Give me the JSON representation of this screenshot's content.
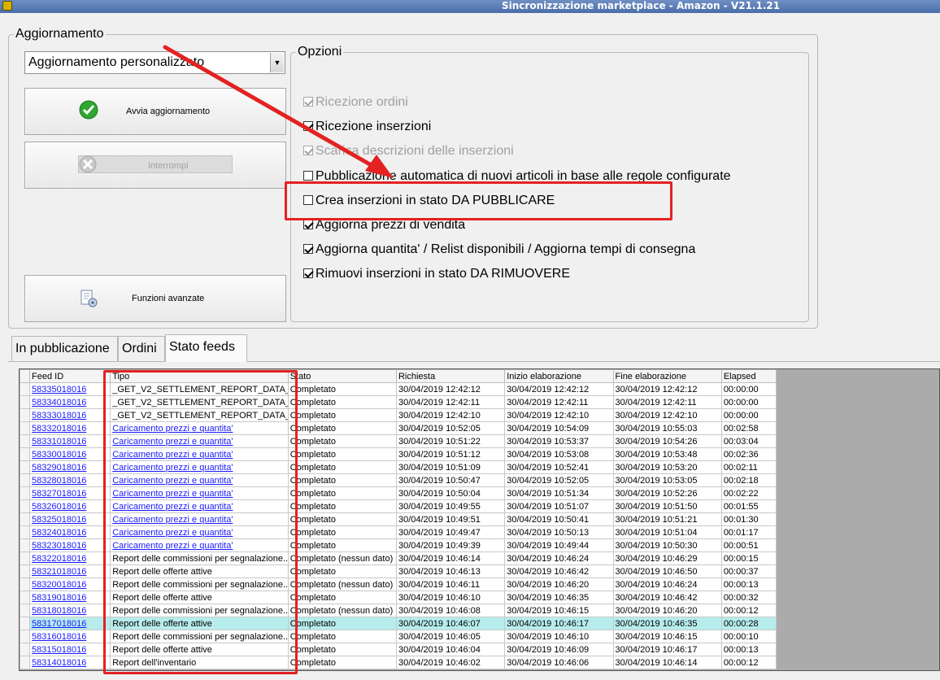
{
  "window": {
    "title": "Sincronizzazione marketplace - Amazon - V21.1.21"
  },
  "update_group": {
    "label": "Aggiornamento",
    "mode_value": "Aggiornamento personalizzato",
    "start_label": "Avvia aggiornamento",
    "stop_label": "Interrompi",
    "advanced_label": "Funzioni avanzate"
  },
  "options": {
    "label": "Opzioni",
    "items": [
      {
        "label": "Ricezione ordini",
        "checked": true,
        "disabled": true
      },
      {
        "label": "Ricezione inserzioni",
        "checked": true,
        "disabled": false
      },
      {
        "label": "Scarica descrizioni delle inserzioni",
        "checked": true,
        "disabled": true
      },
      {
        "label": "Pubblicazione automatica di nuovi articoli in base alle regole configurate",
        "checked": false,
        "disabled": false
      },
      {
        "label": "Crea inserzioni in stato DA PUBBLICARE",
        "checked": false,
        "disabled": false
      },
      {
        "label": "Aggiorna prezzi di vendita",
        "checked": true,
        "disabled": false
      },
      {
        "label": "Aggiorna quantita' / Relist disponibili / Aggiorna tempi di consegna",
        "checked": true,
        "disabled": false
      },
      {
        "label": "Rimuovi inserzioni in stato DA RIMUOVERE",
        "checked": true,
        "disabled": false
      }
    ]
  },
  "tabs": [
    {
      "label": "In pubblicazione",
      "active": false
    },
    {
      "label": "Ordini",
      "active": false
    },
    {
      "label": "Stato feeds",
      "active": true
    }
  ],
  "feeds_table": {
    "columns": [
      "Feed ID",
      "Tipo",
      "Stato",
      "Richiesta",
      "Inizio elaborazione",
      "Fine elaborazione",
      "Elapsed"
    ],
    "rows": [
      {
        "id": "58335018016",
        "tipo": "_GET_V2_SETTLEMENT_REPORT_DATA_...",
        "tipo_link": false,
        "stato": "Completato",
        "richiesta": "30/04/2019 12:42:12",
        "inizio": "30/04/2019 12:42:12",
        "fine": "30/04/2019 12:42:12",
        "elapsed": "00:00:00"
      },
      {
        "id": "58334018016",
        "tipo": "_GET_V2_SETTLEMENT_REPORT_DATA_...",
        "tipo_link": false,
        "stato": "Completato",
        "richiesta": "30/04/2019 12:42:11",
        "inizio": "30/04/2019 12:42:11",
        "fine": "30/04/2019 12:42:11",
        "elapsed": "00:00:00"
      },
      {
        "id": "58333018016",
        "tipo": "_GET_V2_SETTLEMENT_REPORT_DATA_...",
        "tipo_link": false,
        "stato": "Completato",
        "richiesta": "30/04/2019 12:42:10",
        "inizio": "30/04/2019 12:42:10",
        "fine": "30/04/2019 12:42:10",
        "elapsed": "00:00:00"
      },
      {
        "id": "58332018016",
        "tipo": "Caricamento prezzi e quantita'",
        "tipo_link": true,
        "stato": "Completato",
        "richiesta": "30/04/2019 10:52:05",
        "inizio": "30/04/2019 10:54:09",
        "fine": "30/04/2019 10:55:03",
        "elapsed": "00:02:58"
      },
      {
        "id": "58331018016",
        "tipo": "Caricamento prezzi e quantita'",
        "tipo_link": true,
        "stato": "Completato",
        "richiesta": "30/04/2019 10:51:22",
        "inizio": "30/04/2019 10:53:37",
        "fine": "30/04/2019 10:54:26",
        "elapsed": "00:03:04"
      },
      {
        "id": "58330018016",
        "tipo": "Caricamento prezzi e quantita'",
        "tipo_link": true,
        "stato": "Completato",
        "richiesta": "30/04/2019 10:51:12",
        "inizio": "30/04/2019 10:53:08",
        "fine": "30/04/2019 10:53:48",
        "elapsed": "00:02:36"
      },
      {
        "id": "58329018016",
        "tipo": "Caricamento prezzi e quantita'",
        "tipo_link": true,
        "stato": "Completato",
        "richiesta": "30/04/2019 10:51:09",
        "inizio": "30/04/2019 10:52:41",
        "fine": "30/04/2019 10:53:20",
        "elapsed": "00:02:11"
      },
      {
        "id": "58328018016",
        "tipo": "Caricamento prezzi e quantita'",
        "tipo_link": true,
        "stato": "Completato",
        "richiesta": "30/04/2019 10:50:47",
        "inizio": "30/04/2019 10:52:05",
        "fine": "30/04/2019 10:53:05",
        "elapsed": "00:02:18"
      },
      {
        "id": "58327018016",
        "tipo": "Caricamento prezzi e quantita'",
        "tipo_link": true,
        "stato": "Completato",
        "richiesta": "30/04/2019 10:50:04",
        "inizio": "30/04/2019 10:51:34",
        "fine": "30/04/2019 10:52:26",
        "elapsed": "00:02:22"
      },
      {
        "id": "58326018016",
        "tipo": "Caricamento prezzi e quantita'",
        "tipo_link": true,
        "stato": "Completato",
        "richiesta": "30/04/2019 10:49:55",
        "inizio": "30/04/2019 10:51:07",
        "fine": "30/04/2019 10:51:50",
        "elapsed": "00:01:55"
      },
      {
        "id": "58325018016",
        "tipo": "Caricamento prezzi e quantita'",
        "tipo_link": true,
        "stato": "Completato",
        "richiesta": "30/04/2019 10:49:51",
        "inizio": "30/04/2019 10:50:41",
        "fine": "30/04/2019 10:51:21",
        "elapsed": "00:01:30"
      },
      {
        "id": "58324018016",
        "tipo": "Caricamento prezzi e quantita'",
        "tipo_link": true,
        "stato": "Completato",
        "richiesta": "30/04/2019 10:49:47",
        "inizio": "30/04/2019 10:50:13",
        "fine": "30/04/2019 10:51:04",
        "elapsed": "00:01:17"
      },
      {
        "id": "58323018016",
        "tipo": "Caricamento prezzi e quantita'",
        "tipo_link": true,
        "stato": "Completato",
        "richiesta": "30/04/2019 10:49:39",
        "inizio": "30/04/2019 10:49:44",
        "fine": "30/04/2019 10:50:30",
        "elapsed": "00:00:51"
      },
      {
        "id": "58322018016",
        "tipo": "Report delle commissioni per segnalazione...",
        "tipo_link": false,
        "stato": "Completato (nessun dato)",
        "richiesta": "30/04/2019 10:46:14",
        "inizio": "30/04/2019 10:46:24",
        "fine": "30/04/2019 10:46:29",
        "elapsed": "00:00:15"
      },
      {
        "id": "58321018016",
        "tipo": "Report delle offerte attive",
        "tipo_link": false,
        "stato": "Completato",
        "richiesta": "30/04/2019 10:46:13",
        "inizio": "30/04/2019 10:46:42",
        "fine": "30/04/2019 10:46:50",
        "elapsed": "00:00:37"
      },
      {
        "id": "58320018016",
        "tipo": "Report delle commissioni per segnalazione...",
        "tipo_link": false,
        "stato": "Completato (nessun dato)",
        "richiesta": "30/04/2019 10:46:11",
        "inizio": "30/04/2019 10:46:20",
        "fine": "30/04/2019 10:46:24",
        "elapsed": "00:00:13"
      },
      {
        "id": "58319018016",
        "tipo": "Report delle offerte attive",
        "tipo_link": false,
        "stato": "Completato",
        "richiesta": "30/04/2019 10:46:10",
        "inizio": "30/04/2019 10:46:35",
        "fine": "30/04/2019 10:46:42",
        "elapsed": "00:00:32"
      },
      {
        "id": "58318018016",
        "tipo": "Report delle commissioni per segnalazione...",
        "tipo_link": false,
        "stato": "Completato (nessun dato)",
        "richiesta": "30/04/2019 10:46:08",
        "inizio": "30/04/2019 10:46:15",
        "fine": "30/04/2019 10:46:20",
        "elapsed": "00:00:12"
      },
      {
        "id": "58317018016",
        "tipo": "Report delle offerte attive",
        "tipo_link": false,
        "stato": "Completato",
        "richiesta": "30/04/2019 10:46:07",
        "inizio": "30/04/2019 10:46:17",
        "fine": "30/04/2019 10:46:35",
        "elapsed": "00:00:28",
        "selected": true
      },
      {
        "id": "58316018016",
        "tipo": "Report delle commissioni per segnalazione...",
        "tipo_link": false,
        "stato": "Completato",
        "richiesta": "30/04/2019 10:46:05",
        "inizio": "30/04/2019 10:46:10",
        "fine": "30/04/2019 10:46:15",
        "elapsed": "00:00:10"
      },
      {
        "id": "58315018016",
        "tipo": "Report delle offerte attive",
        "tipo_link": false,
        "stato": "Completato",
        "richiesta": "30/04/2019 10:46:04",
        "inizio": "30/04/2019 10:46:09",
        "fine": "30/04/2019 10:46:17",
        "elapsed": "00:00:13"
      },
      {
        "id": "58314018016",
        "tipo": "Report dell'inventario",
        "tipo_link": false,
        "stato": "Completato",
        "richiesta": "30/04/2019 10:46:02",
        "inizio": "30/04/2019 10:46:06",
        "fine": "30/04/2019 10:46:14",
        "elapsed": "00:00:12"
      }
    ]
  },
  "colors": {
    "annotation": "#e32222",
    "selected_row": "#b7ecec",
    "link": "#1a1aff"
  }
}
